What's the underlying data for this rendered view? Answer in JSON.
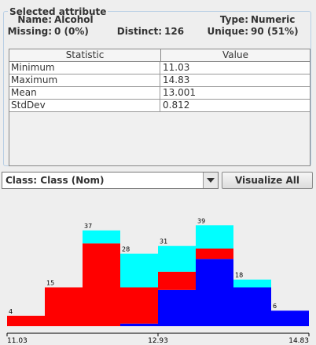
{
  "panel": {
    "title": "Selected attribute",
    "name_label": "Name:",
    "name_value": "Alcohol",
    "type_label": "Type:",
    "type_value": "Numeric",
    "missing_label": "Missing:",
    "missing_value": "0 (0%)",
    "distinct_label": "Distinct:",
    "distinct_value": "126",
    "unique_label": "Unique:",
    "unique_value": "90 (51%)"
  },
  "table": {
    "headers": [
      "Statistic",
      "Value"
    ],
    "rows": [
      [
        "Minimum",
        "11.03"
      ],
      [
        "Maximum",
        "14.83"
      ],
      [
        "Mean",
        "13.001"
      ],
      [
        "StdDev",
        "0.812"
      ]
    ]
  },
  "class_select": {
    "value": "Class: Class (Nom)"
  },
  "visualize_button": "Visualize All",
  "colors": {
    "class1": "#0000ff",
    "class2": "#ff0000",
    "class3": "#00ffff",
    "border": "#b8cfe5"
  },
  "chart_data": {
    "type": "bar",
    "stacked": true,
    "x_min": "11.03",
    "x_mid": "12.93",
    "x_max": "14.83",
    "totals": [
      4,
      15,
      37,
      28,
      31,
      39,
      18,
      6
    ],
    "series": [
      {
        "color": "#0000ff",
        "values": [
          0,
          0,
          0,
          1,
          14,
          26,
          15,
          6
        ]
      },
      {
        "color": "#ff0000",
        "values": [
          4,
          15,
          32,
          14,
          7,
          4,
          0,
          0
        ]
      },
      {
        "color": "#00ffff",
        "values": [
          0,
          0,
          5,
          13,
          10,
          9,
          3,
          0
        ]
      }
    ]
  }
}
